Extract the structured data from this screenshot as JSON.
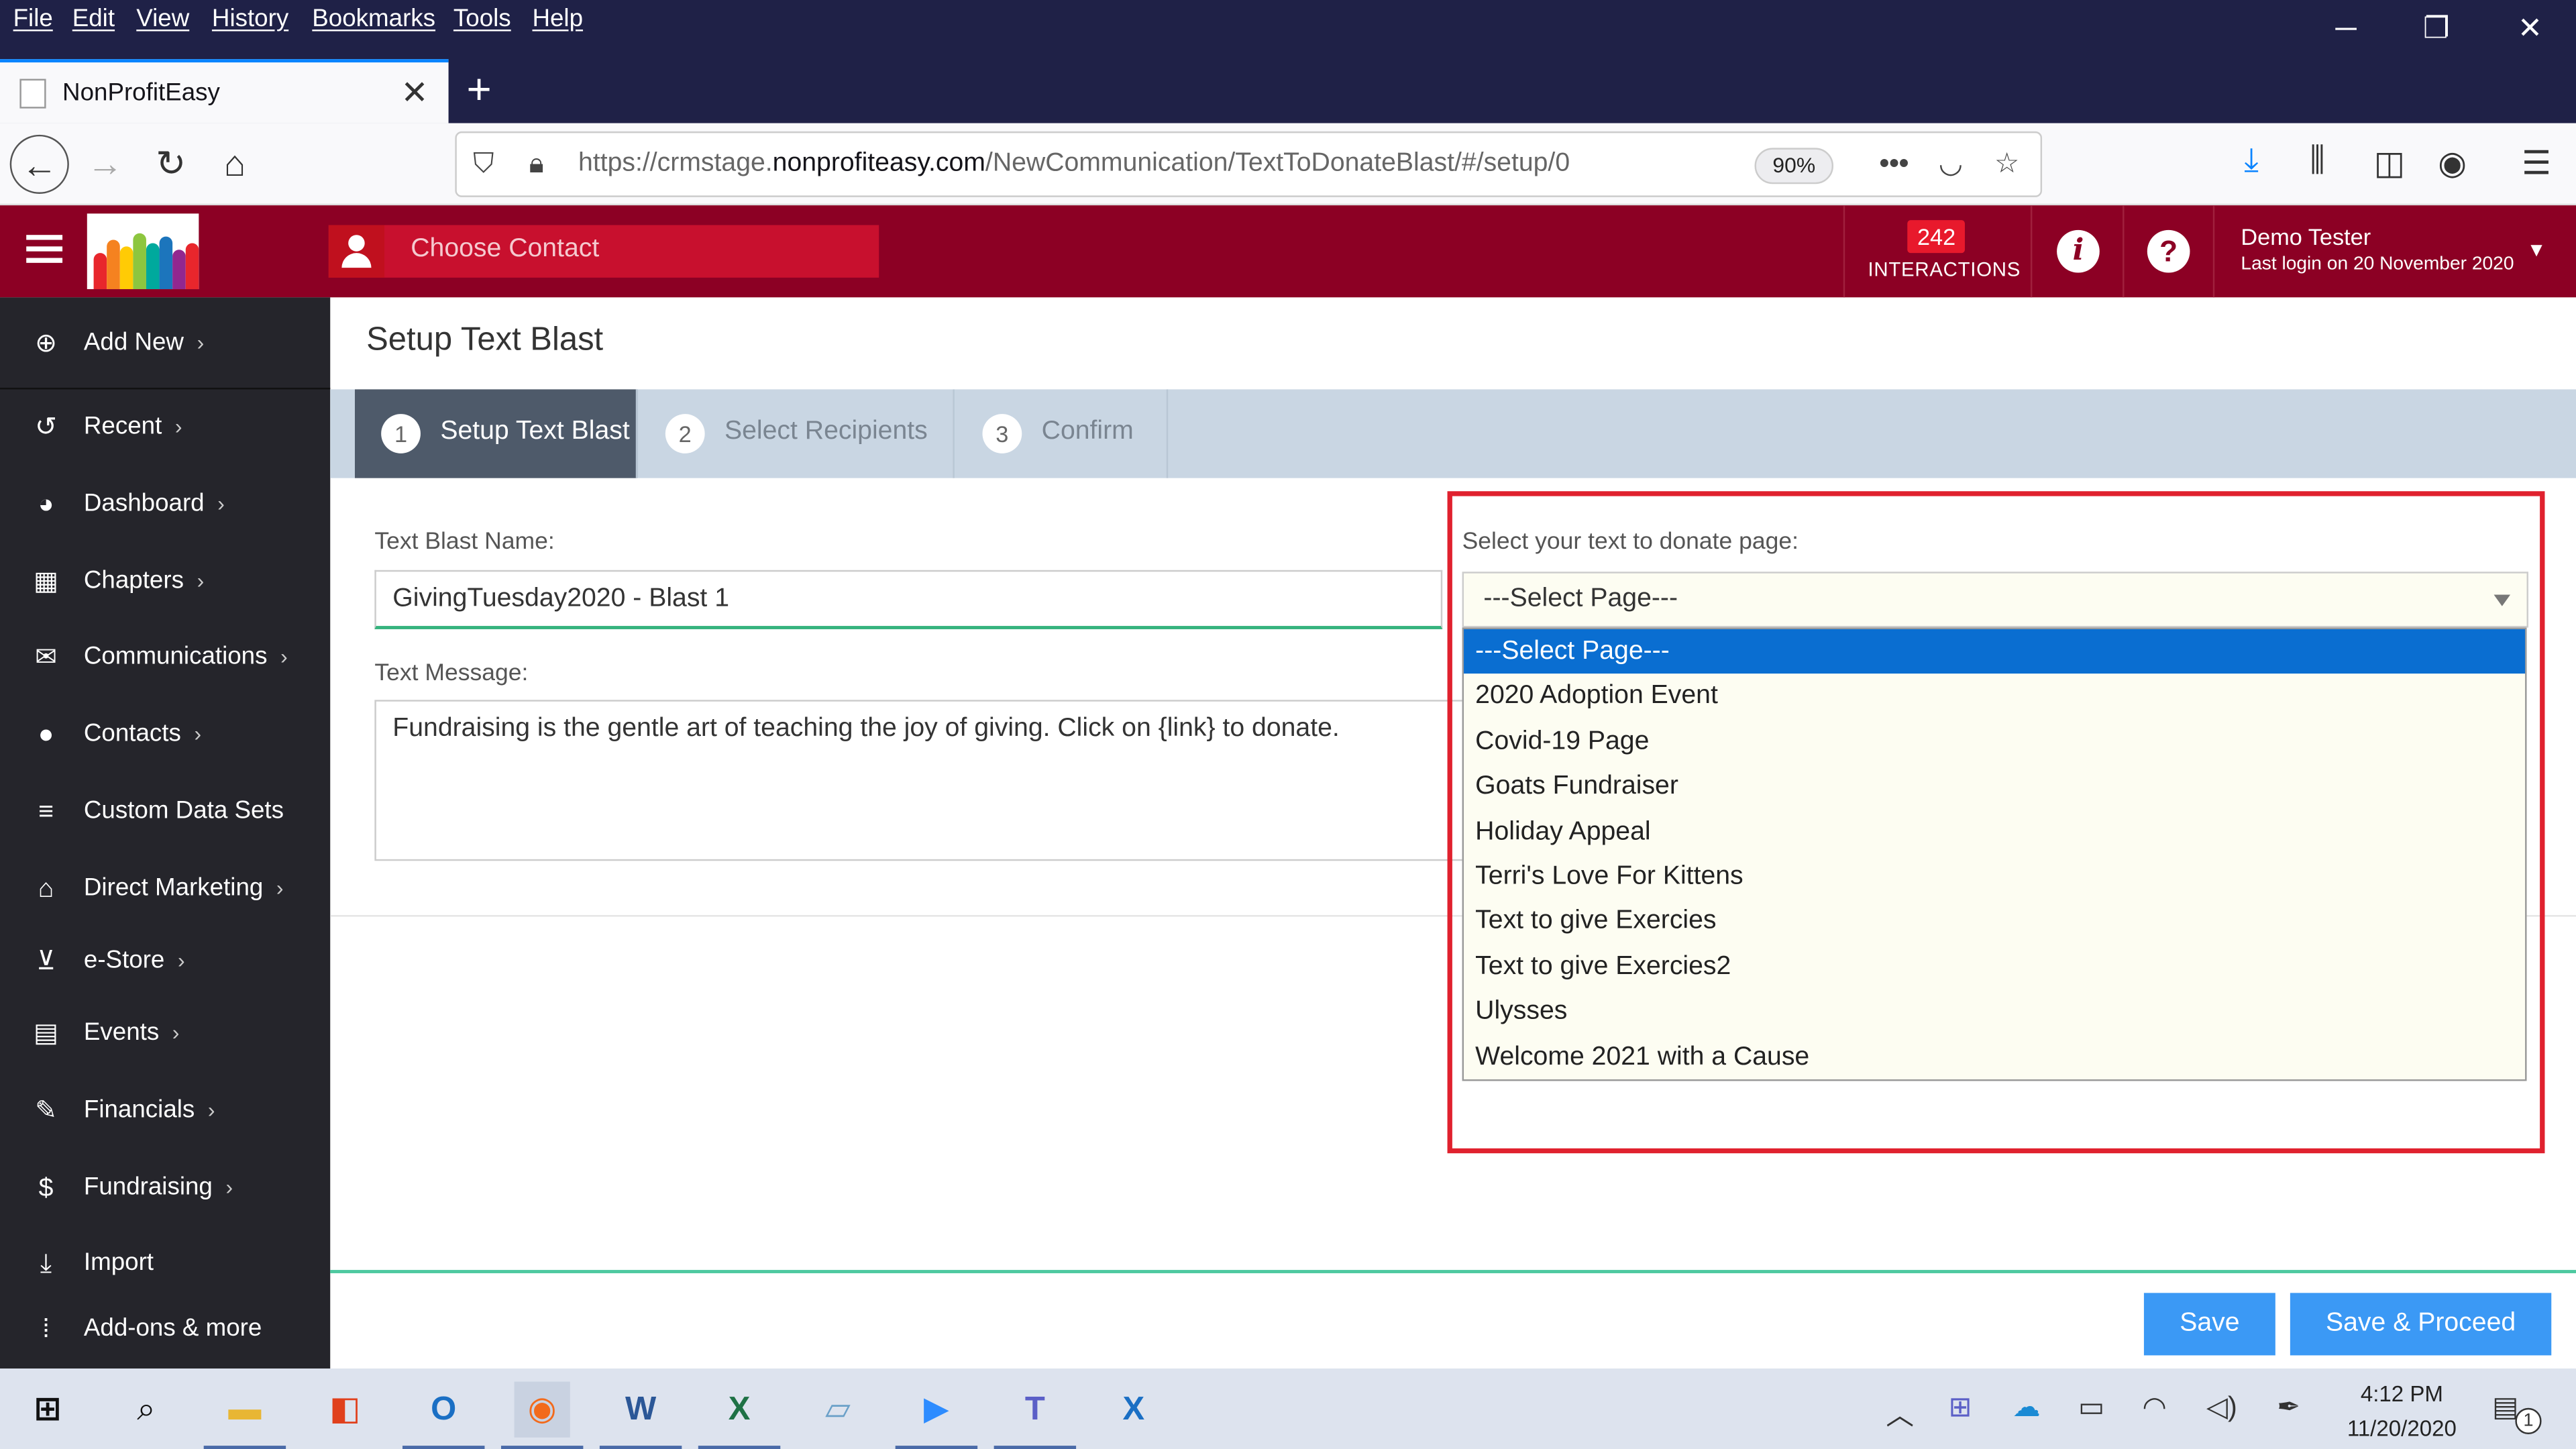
{
  "browser": {
    "menu": [
      "File",
      "Edit",
      "View",
      "History",
      "Bookmarks",
      "Tools",
      "Help"
    ],
    "tab_title": "NonProfitEasy",
    "url_prefix": "https://crmstage.",
    "url_domain": "nonprofiteasy.com",
    "url_path": "/NewCommunication/TextToDonateBlast/#/setup/0",
    "zoom": "90%"
  },
  "header": {
    "search_placeholder": "Choose Contact",
    "interactions_count": "242",
    "interactions_label": "INTERACTIONS",
    "user_name": "Demo Tester",
    "last_login": "Last login on 20 November 2020"
  },
  "sidebar": {
    "items": [
      {
        "label": "Add New",
        "icon": "plus-circle-icon",
        "glyph": "⊕",
        "chevron": true
      },
      {
        "label": "Recent",
        "icon": "history-icon",
        "glyph": "↺",
        "chevron": true
      },
      {
        "label": "Dashboard",
        "icon": "dashboard-icon",
        "glyph": "◕",
        "chevron": true
      },
      {
        "label": "Chapters",
        "icon": "grid-icon",
        "glyph": "▦",
        "chevron": true
      },
      {
        "label": "Communications",
        "icon": "envelope-icon",
        "glyph": "✉",
        "chevron": true
      },
      {
        "label": "Contacts",
        "icon": "user-icon",
        "glyph": "●",
        "chevron": true
      },
      {
        "label": "Custom Data Sets",
        "icon": "database-icon",
        "glyph": "≡",
        "chevron": false
      },
      {
        "label": "Direct Marketing",
        "icon": "bank-icon",
        "glyph": "⌂",
        "chevron": true
      },
      {
        "label": "e-Store",
        "icon": "cart-icon",
        "glyph": "⊻",
        "chevron": true
      },
      {
        "label": "Events",
        "icon": "calendar-icon",
        "glyph": "▤",
        "chevron": true
      },
      {
        "label": "Financials",
        "icon": "money-icon",
        "glyph": "✎",
        "chevron": true
      },
      {
        "label": "Fundraising",
        "icon": "moneybag-icon",
        "glyph": "$",
        "chevron": true
      },
      {
        "label": "Import",
        "icon": "download-icon",
        "glyph": "⤓",
        "chevron": false
      },
      {
        "label": "Add-ons & more",
        "icon": "apps-grid-icon",
        "glyph": "⁞",
        "chevron": false
      }
    ]
  },
  "main": {
    "title": "Setup Text Blast",
    "steps": [
      {
        "num": "1",
        "label": "Setup Text Blast"
      },
      {
        "num": "2",
        "label": "Select Recipients"
      },
      {
        "num": "3",
        "label": "Confirm"
      }
    ],
    "name_label": "Text Blast Name:",
    "name_value": "GivingTuesday2020 - Blast 1",
    "message_label": "Text Message:",
    "message_value": "Fundraising is the gentle art of teaching the joy of giving. Click on {link} to donate.",
    "page_label": "Select your text to donate page:",
    "page_selected": "---Select Page---",
    "page_options": [
      "---Select Page---",
      "2020 Adoption Event",
      "Covid-19 Page",
      "Goats Fundraiser",
      "Holiday Appeal",
      "Terri's Love For Kittens",
      "Text to give Exercies",
      "Text to give Exercies2",
      "Ulysses",
      "Welcome 2021 with a Cause"
    ],
    "save_label": "Save",
    "save_proceed_label": "Save & Proceed"
  },
  "taskbar": {
    "time": "4:12 PM",
    "date": "11/20/2020",
    "notification_count": "1"
  },
  "colors": {
    "brand": "#8c0024",
    "accent": "#3b99f5",
    "highlight": "#e0212e"
  }
}
